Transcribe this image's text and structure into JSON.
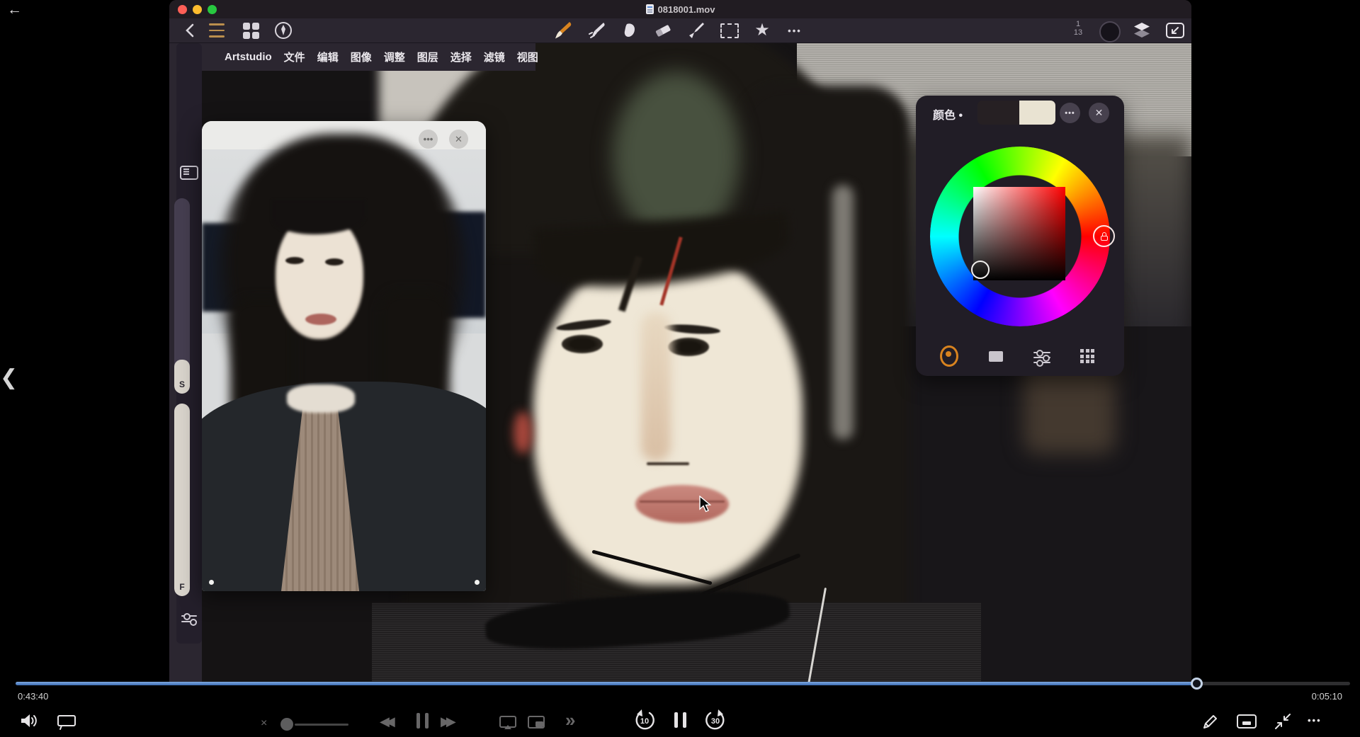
{
  "window": {
    "title": "0818001.mov"
  },
  "player": {
    "elapsed": "0:43:40",
    "remaining": "0:05:10",
    "progress_percent": 88.5,
    "skip_back_label": "10",
    "skip_forward_label": "30",
    "accent_blue": "#4d86c8"
  },
  "app": {
    "menu_items": [
      "Artstudio",
      "文件",
      "编辑",
      "图像",
      "调整",
      "图层",
      "选择",
      "滤镜",
      "视图"
    ],
    "toolbar": {
      "layer_num_top": "1",
      "layer_num_bottom": "13",
      "tools": [
        "paint-brush",
        "wet-brush",
        "smudge",
        "eraser",
        "marker",
        "rect-select",
        "favorites",
        "more"
      ]
    },
    "sidebar": {
      "slider_s": "S",
      "slider_f": "F"
    },
    "color_panel": {
      "title": "颜色 •",
      "swatch_primary": "#262023",
      "swatch_secondary": "#e9e3d2",
      "hue_selected": "#ff0000"
    }
  },
  "icons": {
    "back_arrow": "←",
    "prev_chevron": "❮",
    "star": "★",
    "ellipsis_h": "•••",
    "close_x": "✕",
    "rewind": "◀◀",
    "forward": "▶▶",
    "double_chevron": "»",
    "mute": "×"
  }
}
